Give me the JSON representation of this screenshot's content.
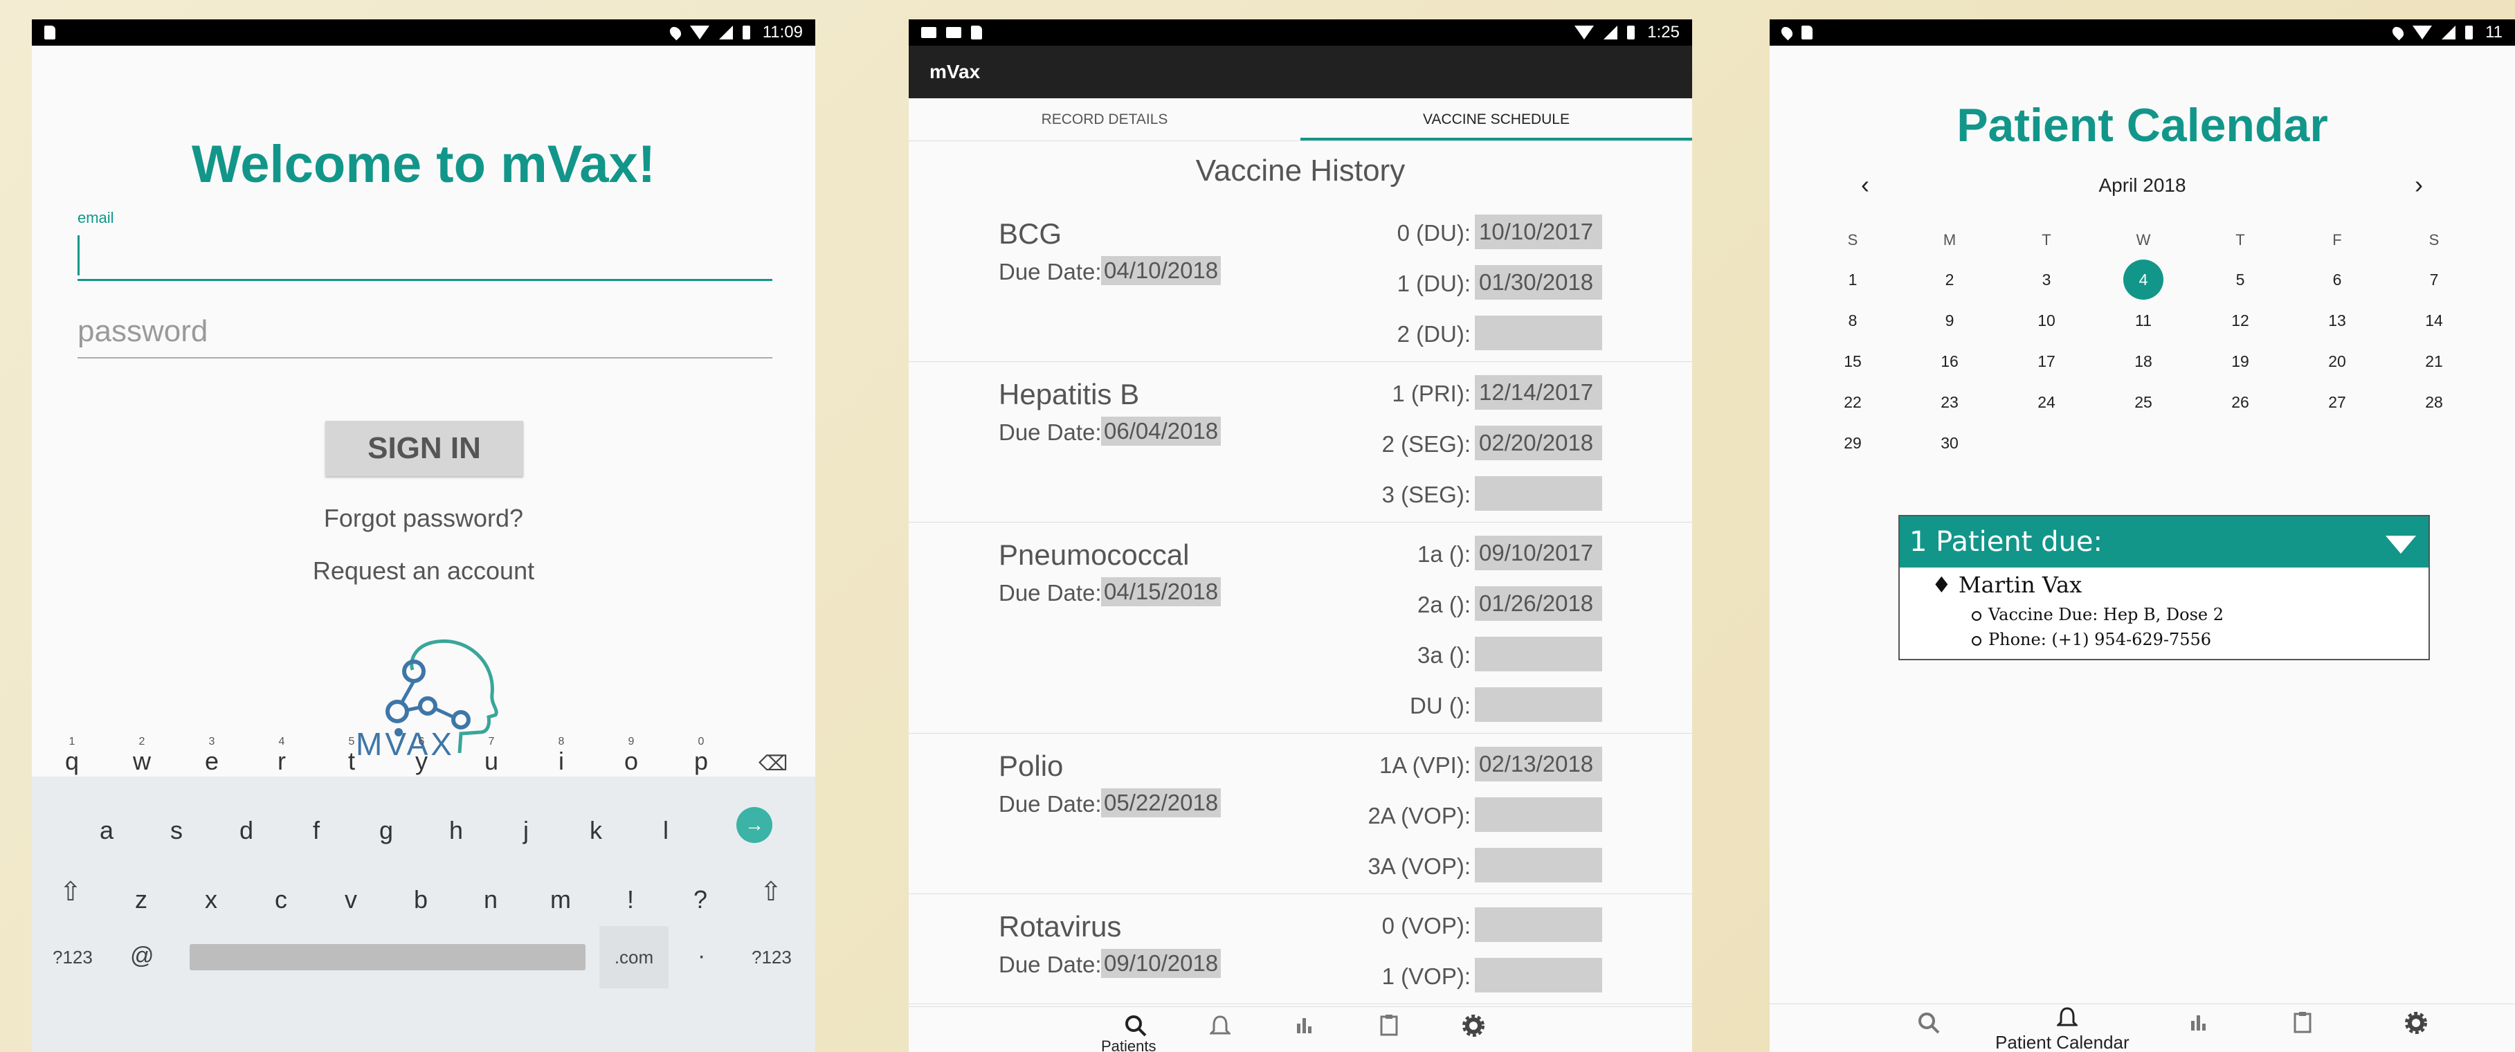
{
  "login": {
    "status_time": "11:09",
    "title": "Welcome to mVax!",
    "email_label": "email",
    "email_value": "",
    "password_placeholder": "password",
    "sign_in_label": "SIGN IN",
    "forgot_label": "Forgot password?",
    "request_label": "Request an account",
    "logo_text": "MVAX",
    "keyboard": {
      "row1": [
        "q",
        "w",
        "e",
        "r",
        "t",
        "y",
        "u",
        "i",
        "o",
        "p"
      ],
      "row1_hints": [
        "1",
        "2",
        "3",
        "4",
        "5",
        "6",
        "7",
        "8",
        "9",
        "0"
      ],
      "row2": [
        "a",
        "s",
        "d",
        "f",
        "g",
        "h",
        "j",
        "k",
        "l"
      ],
      "row3": [
        "z",
        "x",
        "c",
        "v",
        "b",
        "n",
        "m",
        "!",
        "?"
      ],
      "symbols_label": "?123",
      "at_label": "@",
      "dotcom_label": ".com",
      "period_label": "·",
      "symbols_right_label": "?123"
    }
  },
  "schedule": {
    "status_time": "1:25",
    "app_title": "mVax",
    "tabs": [
      "RECORD DETAILS",
      "VACCINE SCHEDULE"
    ],
    "history_title": "Vaccine History",
    "due_date_label": "Due Date:",
    "vaccines": [
      {
        "name": "BCG",
        "due": "04/10/2018",
        "doses": [
          {
            "label": "0 (DU):",
            "date": "10/10/2017"
          },
          {
            "label": "1 (DU):",
            "date": "01/30/2018"
          },
          {
            "label": "2 (DU):",
            "date": ""
          }
        ]
      },
      {
        "name": "Hepatitis B",
        "due": "06/04/2018",
        "doses": [
          {
            "label": "1 (PRI):",
            "date": "12/14/2017"
          },
          {
            "label": "2 (SEG):",
            "date": "02/20/2018"
          },
          {
            "label": "3 (SEG):",
            "date": ""
          }
        ]
      },
      {
        "name": "Pneumococcal",
        "due": "04/15/2018",
        "doses": [
          {
            "label": "1a ():",
            "date": "09/10/2017"
          },
          {
            "label": "2a ():",
            "date": "01/26/2018"
          },
          {
            "label": "3a ():",
            "date": ""
          },
          {
            "label": "DU ():",
            "date": ""
          }
        ]
      },
      {
        "name": "Polio",
        "due": "05/22/2018",
        "doses": [
          {
            "label": "1A (VPI):",
            "date": "02/13/2018"
          },
          {
            "label": "2A (VOP):",
            "date": ""
          },
          {
            "label": "3A (VOP):",
            "date": ""
          }
        ]
      },
      {
        "name": "Rotavirus",
        "due": "09/10/2018",
        "doses": [
          {
            "label": "0 (VOP):",
            "date": ""
          },
          {
            "label": "1 (VOP):",
            "date": ""
          }
        ]
      }
    ],
    "nav_caption": "Patients"
  },
  "calendar": {
    "status_time": "11",
    "title": "Patient Calendar",
    "month": "April 2018",
    "weekdays": [
      "S",
      "M",
      "T",
      "W",
      "T",
      "F",
      "S"
    ],
    "today": "4",
    "days": [
      [
        "1",
        "2",
        "3",
        "4",
        "5",
        "6",
        "7"
      ],
      [
        "8",
        "9",
        "10",
        "11",
        "12",
        "13",
        "14"
      ],
      [
        "15",
        "16",
        "17",
        "18",
        "19",
        "20",
        "21"
      ],
      [
        "22",
        "23",
        "24",
        "25",
        "26",
        "27",
        "28"
      ],
      [
        "29",
        "30",
        "",
        "",
        "",
        "",
        ""
      ]
    ],
    "due_header": "1 Patient due:",
    "patient_name": "Martin Vax",
    "vaccine_due": "Vaccine Due: Hep B, Dose 2",
    "phone": "Phone: (+1) 954-629-7556",
    "nav_caption": "Patient Calendar"
  }
}
